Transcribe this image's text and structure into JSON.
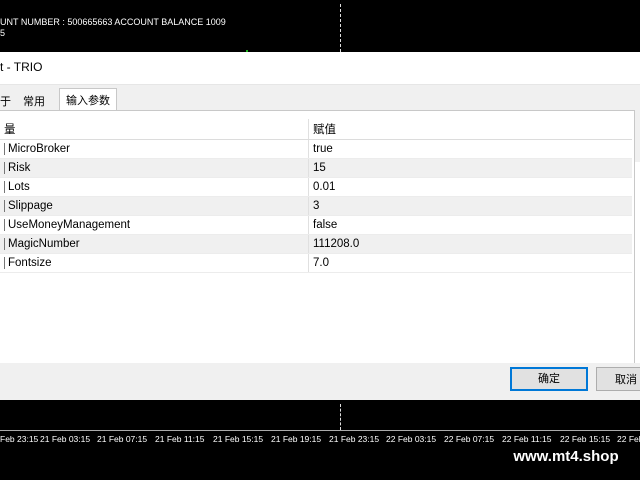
{
  "chart": {
    "info_line_1": "UNT NUMBER : 500665663 ACCOUNT BALANCE 1009",
    "info_line_2": "5",
    "time_labels": [
      "Feb 23:15",
      "21 Feb 03:15",
      "21 Feb 07:15",
      "21 Feb 11:15",
      "21 Feb 15:15",
      "21 Feb 19:15",
      "21 Feb 23:15",
      "22 Feb 03:15",
      "22 Feb 07:15",
      "22 Feb 11:15",
      "22 Feb 15:15",
      "22 Feb 1"
    ],
    "watermark": "www.mt4.shop"
  },
  "dialog": {
    "title": "t - TRIO",
    "tabs": [
      {
        "label": "于",
        "active": false
      },
      {
        "label": "常用",
        "active": false
      },
      {
        "label": "输入参数",
        "active": true
      }
    ],
    "columns": [
      "量",
      "赋值"
    ],
    "rows": [
      {
        "name": "MicroBroker",
        "value": "true"
      },
      {
        "name": "Risk",
        "value": "15"
      },
      {
        "name": "Lots",
        "value": "0.01"
      },
      {
        "name": "Slippage",
        "value": "3"
      },
      {
        "name": "UseMoneyManagement",
        "value": "false"
      },
      {
        "name": "MagicNumber",
        "value": "111208.0"
      },
      {
        "name": "Fontsize",
        "value": "7.0"
      }
    ],
    "buttons": {
      "ok": "确定",
      "cancel": "取消"
    }
  }
}
